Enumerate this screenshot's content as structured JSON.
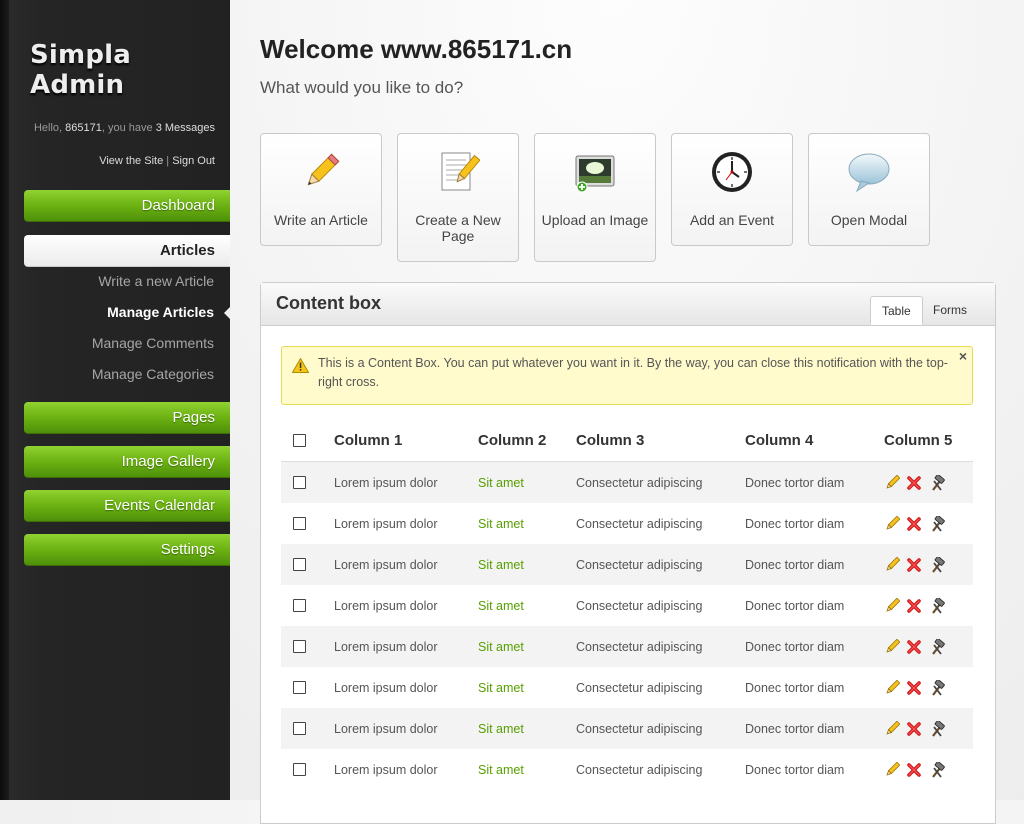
{
  "sidebar": {
    "logo": "Simpla Admin",
    "profile": {
      "greeting": "Hello,",
      "username": "865171",
      "have_text": ", you have",
      "messages": "3 Messages",
      "view_site": "View the Site",
      "separator": "|",
      "sign_out": "Sign Out"
    },
    "nav": {
      "dashboard": "Dashboard",
      "articles": "Articles",
      "pages": "Pages",
      "image_gallery": "Image Gallery",
      "events_calendar": "Events Calendar",
      "settings": "Settings"
    },
    "articles_sub": [
      "Write a new Article",
      "Manage Articles",
      "Manage Comments",
      "Manage Categories"
    ]
  },
  "main": {
    "title": "Welcome www.865171.cn",
    "subtitle": "What would you like to do?",
    "shortcuts": [
      {
        "label": "Write an Article",
        "icon": "pencil-icon"
      },
      {
        "label": "Create a New Page",
        "icon": "paper-pencil-icon"
      },
      {
        "label": "Upload an Image",
        "icon": "image-upload-icon"
      },
      {
        "label": "Add an Event",
        "icon": "clock-icon"
      },
      {
        "label": "Open Modal",
        "icon": "speech-bubble-icon"
      }
    ]
  },
  "content_box": {
    "title": "Content box",
    "tabs": [
      "Table",
      "Forms"
    ],
    "notification": "This is a Content Box. You can put whatever you want in it. By the way, you can close this notification with the top-right cross.",
    "close_glyph": "×",
    "columns": [
      "Column 1",
      "Column 2",
      "Column 3",
      "Column 4",
      "Column 5"
    ],
    "rows": [
      [
        "Lorem ipsum dolor",
        "Sit amet",
        "Consectetur adipiscing",
        "Donec tortor diam"
      ],
      [
        "Lorem ipsum dolor",
        "Sit amet",
        "Consectetur adipiscing",
        "Donec tortor diam"
      ],
      [
        "Lorem ipsum dolor",
        "Sit amet",
        "Consectetur adipiscing",
        "Donec tortor diam"
      ],
      [
        "Lorem ipsum dolor",
        "Sit amet",
        "Consectetur adipiscing",
        "Donec tortor diam"
      ],
      [
        "Lorem ipsum dolor",
        "Sit amet",
        "Consectetur adipiscing",
        "Donec tortor diam"
      ],
      [
        "Lorem ipsum dolor",
        "Sit amet",
        "Consectetur adipiscing",
        "Donec tortor diam"
      ],
      [
        "Lorem ipsum dolor",
        "Sit amet",
        "Consectetur adipiscing",
        "Donec tortor diam"
      ],
      [
        "Lorem ipsum dolor",
        "Sit amet",
        "Consectetur adipiscing",
        "Donec tortor diam"
      ]
    ],
    "row_actions": [
      "edit-pencil-icon",
      "delete-cross-icon",
      "hammer-icon"
    ]
  },
  "colors": {
    "accent_green": "#6cb212",
    "link_green": "#57a000",
    "sidebar_dark": "#222222",
    "notification_bg": "#fffbcc"
  }
}
